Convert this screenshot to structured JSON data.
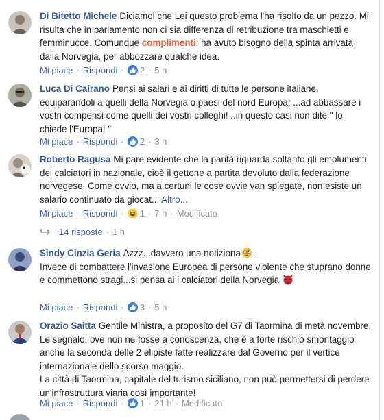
{
  "actions": {
    "like": "Mi piace",
    "reply": "Rispondi",
    "modified": "Modificato"
  },
  "comments": [
    {
      "author": "Di Bitetto Michele",
      "text_before": "Diciamol che Lei questo problema l'ha risolto da un pezzo. Mi risulta che in parlamento non ci sia differenza di retribuzione tra maschietti e femminucce. Comunque ",
      "highlight": "complimenti",
      "text_after": ": ha avuto bisogno della spinta arrivata dalla Norvegia, per abbozzare qualche idea.",
      "likes": "2",
      "time": "5 h",
      "reaction": "like",
      "avatar_color": "#8a7d70"
    },
    {
      "author": "Luca Di Cairano",
      "text": "Pensi ai salari e ai diritti di tutte le persone italiane, equiparandoli a quelli della Norvegia o paesi del nord Europa! ...ad abbassare i vostri compensi come quelli dei vostri colleghi! ..in questo casi non dite \" lo chiede l'Europa! \"",
      "likes": "2",
      "time": "3 h",
      "reaction": "like",
      "avatar_color": "#5b6b57"
    },
    {
      "author": "Roberto Ragusa",
      "text": "Mi pare evidente che la parità riguarda soltanto gli emolumenti dei calciatori in nazionale, cioè il gettone a partita devoluto dalla federazione norvegese. Come ovvio, ma a certuni le cose ovvie van spiegate, non esiste un salario continuato da giocat... ",
      "more": "Altro...",
      "likes": "1",
      "time": "7 h",
      "reaction": "haha",
      "modified": true,
      "replies": "14 risposte",
      "replies_time": "1 h",
      "avatar_color": "#9c8f84"
    },
    {
      "author": "Sindy Cinzia Geria",
      "text_line1": "Azzz...davvero una notiziona",
      "text_rest": "Invece di combattere l'invasione Europea di persone violente che stuprano donne e commettono stragi...si pensa ai i calciatori della Norvegia",
      "likes": "3",
      "time": "5 h",
      "reaction": "like",
      "avatar_color": "#3c4a78"
    },
    {
      "author": "Orazio Saitta",
      "text": "Gentile Ministra, a proposito del G7 di Taormina di metà novembre, Le segnalo, ove non ne fosse a conoscenza, che è a forte rischio smontaggio anche la seconda delle 2 elipiste fatte realizzare dal Governo per il vertice internazionale dello scorso maggio.",
      "text2": "La città di Taormina, capitale del turismo siciliano, non può permettersi di perdere un'infrastruttura viaria così importante!",
      "likes": "1",
      "time": "21 h",
      "reaction": "like",
      "modified": true,
      "avatar_color": "#2b3f73"
    }
  ],
  "colors": {
    "author": "#365899",
    "link": "#4267b2",
    "meta": "#90949c",
    "highlight": "#f05a3c",
    "like_badge": "#3b7ddd"
  }
}
